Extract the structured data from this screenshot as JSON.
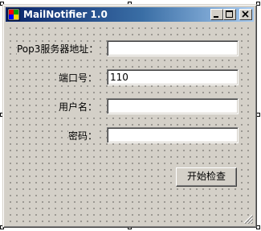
{
  "window": {
    "title": "MailNotifier 1.0",
    "icons": [
      "app-icon",
      "minimize-icon",
      "maximize-icon",
      "close-icon",
      "size-grip-icon"
    ]
  },
  "form": {
    "pop3_label": "Pop3服务器地址：",
    "pop3_value": "",
    "port_label": "端口号：",
    "port_value": "110",
    "user_label": "用户名：",
    "user_value": "",
    "password_label": "密码：",
    "password_value": ""
  },
  "actions": {
    "start_label": "开始检查"
  },
  "colors": {
    "titlebar_start": "#0a246a",
    "titlebar_end": "#a6caf0",
    "face": "#d4d0c8"
  }
}
